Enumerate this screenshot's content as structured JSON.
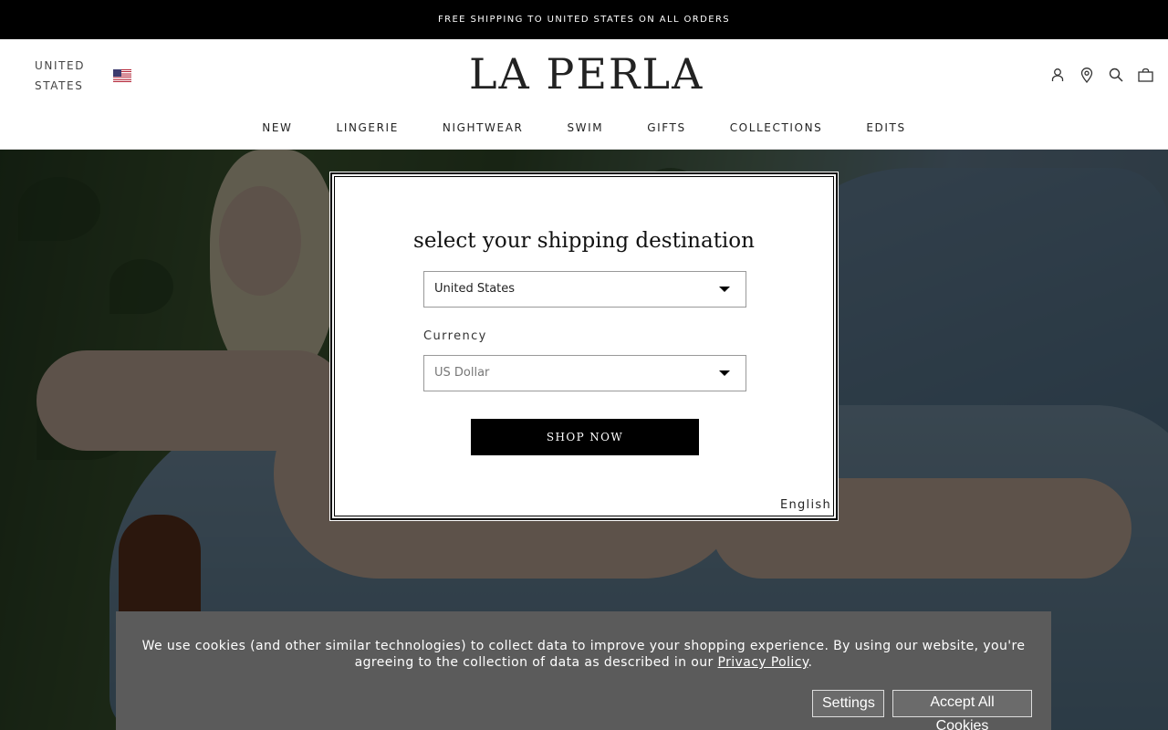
{
  "promo": {
    "text": "FREE SHIPPING TO UNITED STATES ON ALL ORDERS"
  },
  "header": {
    "locale_line1": "UNITED",
    "locale_line2": "STATES",
    "logo": "LA PERLA",
    "nav": [
      "NEW",
      "LINGERIE",
      "NIGHTWEAR",
      "SWIM",
      "GIFTS",
      "COLLECTIONS",
      "EDITS"
    ],
    "icons": [
      "account-icon",
      "store-locator-icon",
      "search-icon",
      "bag-icon"
    ]
  },
  "modal": {
    "title": "select your shipping destination",
    "country_value": "United States",
    "currency_label": "Currency",
    "currency_value": "US Dollar",
    "shop_button": "SHOP NOW",
    "language": "English"
  },
  "cookie": {
    "text_before": "We use cookies (and other similar technologies) to collect data to improve your shopping experience. By using our website, you're agreeing to the collection of data as described in our ",
    "link": "Privacy Policy",
    "text_after": ".",
    "settings_button": "Settings",
    "accept_button": "Accept All Cookies"
  }
}
